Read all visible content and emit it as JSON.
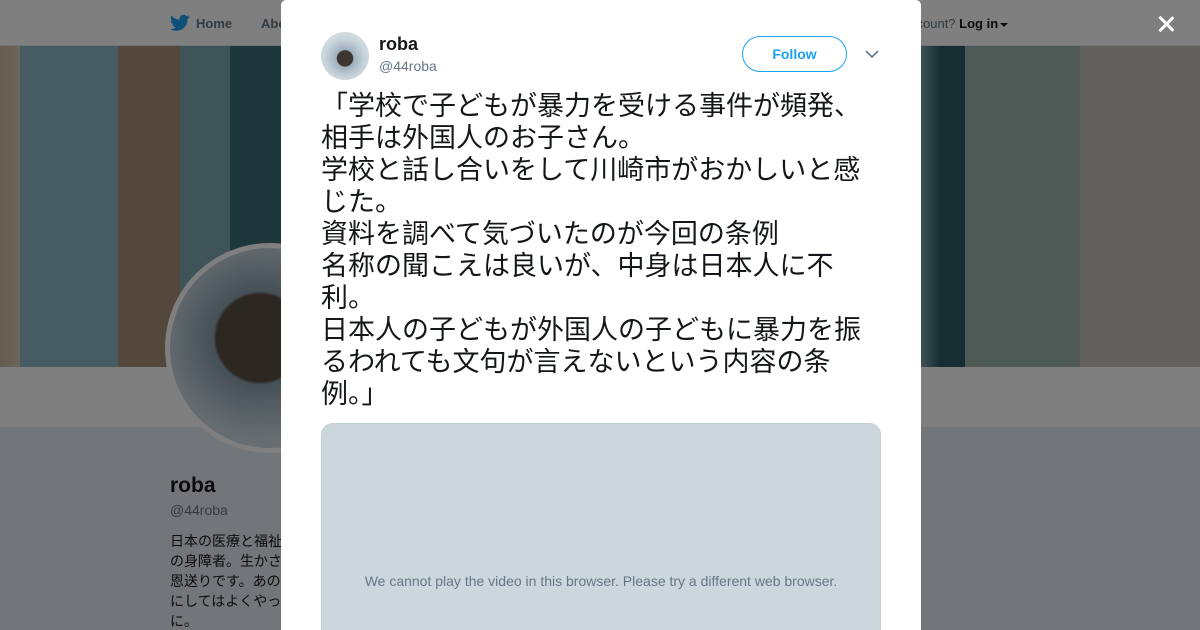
{
  "nav": {
    "home_label": "Home",
    "about_label": "Abo",
    "account_prompt": "ccount?",
    "login_label": "Log in"
  },
  "background_profile": {
    "name": "roba",
    "handle": "@44roba",
    "bio": "日本の医療と福祉\nの身障者。生かさ\n恩送りです。あの\nにしてはよくやっ\nに。"
  },
  "tweet": {
    "author_name": "roba",
    "author_handle": "@44roba",
    "follow_label": "Follow",
    "text": "「学校で子どもが暴力を受ける事件が頻発、\n相手は外国人のお子さん。\n学校と話し合いをして川崎市がおかしいと感\nじた。\n資料を調べて気づいたのが今回の条例\n名称の聞こえは良いが、中身は日本人に不\n利。\n日本人の子どもが外国人の子どもに暴力を振\nるわれても文句が言えないという内容の条\n例。」",
    "video_message": "We cannot play the video in this browser. Please try a different web browser."
  },
  "icons": {
    "home": "twitter-bird-icon",
    "close": "close-icon",
    "more": "chevron-down-icon"
  },
  "colors": {
    "accent": "#1da1f2",
    "text": "#14171a",
    "secondary": "#657786",
    "video_bg": "#ccd6dd"
  }
}
